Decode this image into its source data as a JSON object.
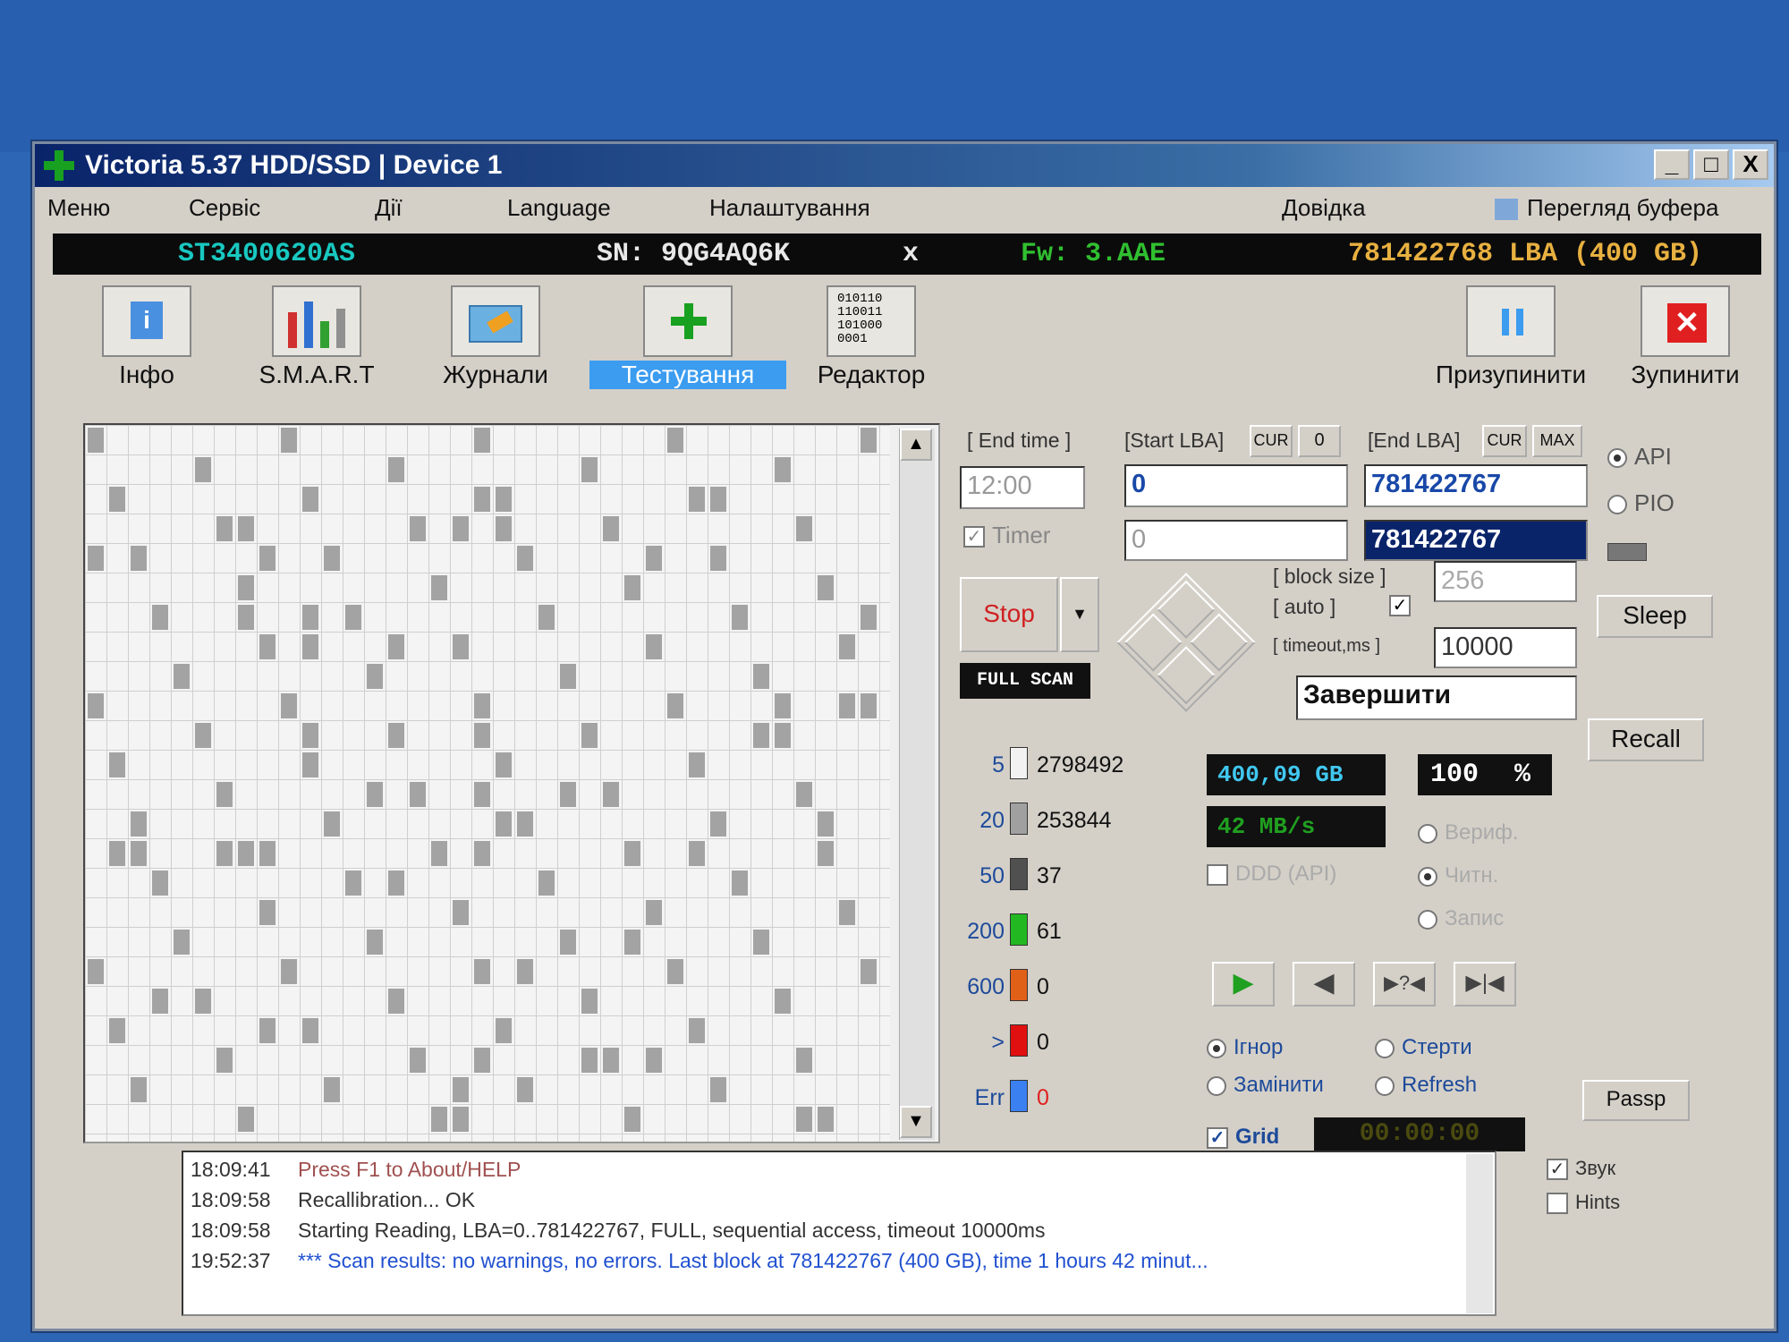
{
  "window": {
    "title": "Victoria 5.37 HDD/SSD | Device 1",
    "min": "_",
    "max": "□",
    "close": "X"
  },
  "menu": [
    "Меню",
    "Сервіс",
    "Дії",
    "Language",
    "Налаштування",
    "Довідка",
    "Перегляд буфера"
  ],
  "device": {
    "model": "ST3400620AS",
    "serial": "SN: 9QG4AQ6K",
    "x": "x",
    "firmware": "Fw: 3.AAE",
    "capacity": "781422768 LBA (400 GB)"
  },
  "toolbar": {
    "info": "Інфо",
    "smart": "S.M.A.R.T",
    "logs": "Журнали",
    "test": "Тестування",
    "editor": "Редактор",
    "pause": "Призупинити",
    "stop": "Зупинити",
    "editor_bits": "010110\n110011\n101000\n0001"
  },
  "scan": {
    "end_time_label": "[ End time ]",
    "start_lba_label": "[Start LBA]",
    "cur": "CUR",
    "zero": "0",
    "end_lba_label": "[End LBA]",
    "cur2": "CUR",
    "max": "MAX",
    "end_time_value": "12:00",
    "start_lba": "0",
    "end_lba": "781422767",
    "timer_label": "Timer",
    "timer_value": "0",
    "end_lba2": "781422767",
    "stop": "Stop",
    "full_scan": "FULL SCAN",
    "block_size_label": "[ block size ]",
    "auto_label": "[ auto ]",
    "timeout_label": "[ timeout,ms ]",
    "block_size": "256",
    "timeout": "10000",
    "finish": "Завершити"
  },
  "stats": [
    {
      "ms": "5",
      "count": "2798492",
      "color": "#f2f2f2"
    },
    {
      "ms": "20",
      "count": "253844",
      "color": "#a0a0a0"
    },
    {
      "ms": "50",
      "count": "37",
      "color": "#505050"
    },
    {
      "ms": "200",
      "count": "61",
      "color": "#22b822"
    },
    {
      "ms": "600",
      "count": "0",
      "color": "#e06018"
    },
    {
      "ms": ">",
      "count": "0",
      "color": "#e01010"
    },
    {
      "ms": "Err",
      "count": "0",
      "color": "#3a80f0"
    }
  ],
  "progress": {
    "size": "400,09 GB",
    "percent": "100",
    "pct_sign": "%",
    "speed": "42 MB/s",
    "timer": "00:00:00"
  },
  "modes": {
    "ddd": "DDD (API)",
    "verify": "Вериф.",
    "read": "Читн.",
    "write": "Запис",
    "ignore": "Ігнор",
    "erase": "Стерти",
    "replace": "Замінити",
    "refresh": "Refresh",
    "grid": "Grid"
  },
  "right": {
    "api": "API",
    "pio": "PIO",
    "sleep": "Sleep",
    "recall": "Recall",
    "passp": "Passp",
    "sound": "Звук",
    "hints": "Hints"
  },
  "log": [
    {
      "time": "18:09:41",
      "text": "Press F1 to About/HELP"
    },
    {
      "time": "18:09:58",
      "text": "Recallibration... OK"
    },
    {
      "time": "18:09:58",
      "text": "Starting Reading, LBA=0..781422767, FULL, sequential access, timeout 10000ms"
    },
    {
      "time": "19:52:37",
      "text": "*** Scan results: no warnings, no errors. Last block at 781422767 (400 GB), time 1 hours 42 minut..."
    }
  ],
  "colors": {
    "title_bar": "#0a246a",
    "active_tab": "#3b9cf0",
    "model_text": "#18c8c0",
    "fw_text": "#30c030",
    "capacity_text": "#e8b040",
    "log_blue": "#2050d0"
  }
}
